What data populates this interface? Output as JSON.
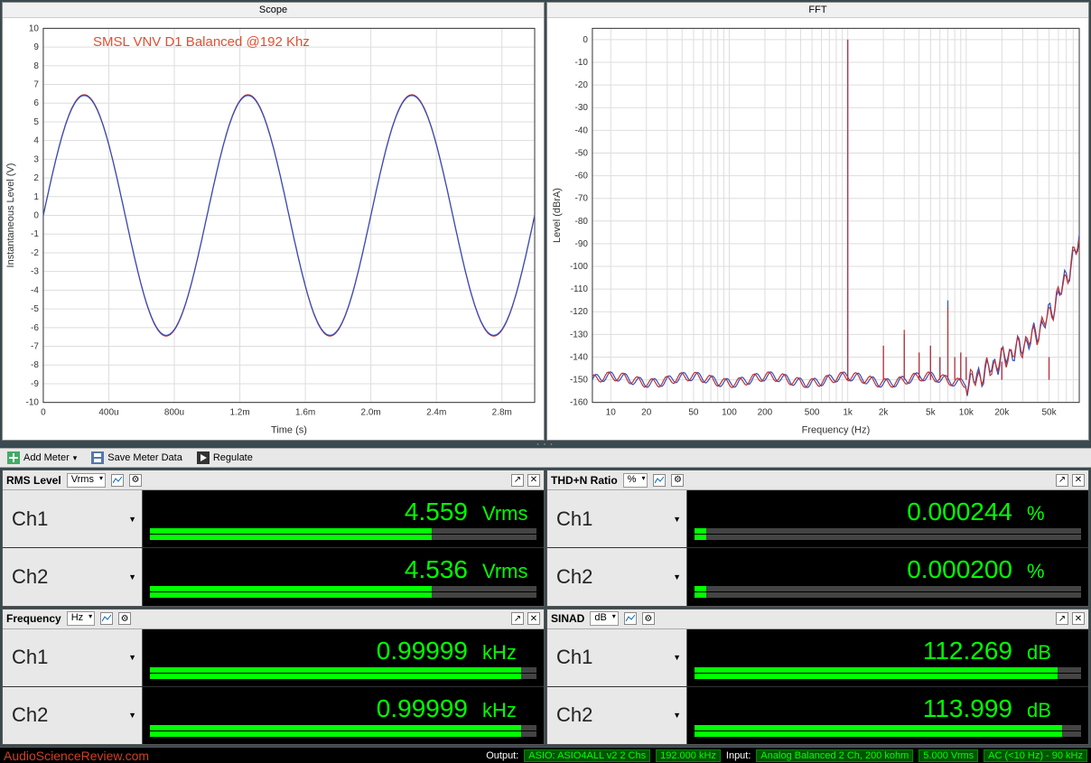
{
  "scope": {
    "title": "Scope",
    "xlabel": "Time (s)",
    "ylabel": "Instantaneous Level (V)",
    "annotation": "SMSL VNV D1 Balanced @192 Khz",
    "x_ticks": [
      "0",
      "400u",
      "800u",
      "1.2m",
      "1.6m",
      "2.0m",
      "2.4m",
      "2.8m"
    ],
    "y_ticks": [
      "-10",
      "-9",
      "-8",
      "-7",
      "-6",
      "-5",
      "-4",
      "-3",
      "-2",
      "-1",
      "0",
      "1",
      "2",
      "3",
      "4",
      "5",
      "6",
      "7",
      "8",
      "9",
      "10"
    ]
  },
  "fft": {
    "title": "FFT",
    "xlabel": "Frequency (Hz)",
    "ylabel": "Level (dBrA)",
    "x_ticks": [
      "10",
      "20",
      "50",
      "100",
      "200",
      "500",
      "1k",
      "2k",
      "5k",
      "10k",
      "20k",
      "50k"
    ],
    "y_ticks": [
      "-160",
      "-150",
      "-140",
      "-130",
      "-120",
      "-110",
      "-100",
      "-90",
      "-80",
      "-70",
      "-60",
      "-50",
      "-40",
      "-30",
      "-20",
      "-10",
      "0"
    ]
  },
  "toolbar": {
    "add_meter": "Add Meter",
    "save_meter": "Save Meter Data",
    "regulate": "Regulate"
  },
  "meters": {
    "rms": {
      "name": "RMS Level",
      "unit": "Vrms",
      "ch1": {
        "value": "4.559",
        "unit": "Vrms",
        "bar1": 73,
        "bar2": 73
      },
      "ch2": {
        "value": "4.536",
        "unit": "Vrms",
        "bar1": 73,
        "bar2": 73
      }
    },
    "thdn": {
      "name": "THD+N Ratio",
      "unit": "%",
      "ch1": {
        "value": "0.000244",
        "unit": "%",
        "bar1": 3,
        "bar2": 3
      },
      "ch2": {
        "value": "0.000200",
        "unit": "%",
        "bar1": 3,
        "bar2": 3
      }
    },
    "freq": {
      "name": "Frequency",
      "unit": "Hz",
      "ch1": {
        "value": "0.99999",
        "unit": "kHz",
        "bar1": 96,
        "bar2": 96
      },
      "ch2": {
        "value": "0.99999",
        "unit": "kHz",
        "bar1": 96,
        "bar2": 96
      }
    },
    "sinad": {
      "name": "SINAD",
      "unit": "dB",
      "ch1": {
        "value": "112.269",
        "unit": "dB",
        "bar1": 94,
        "bar2": 94
      },
      "ch2": {
        "value": "113.999",
        "unit": "dB",
        "bar1": 95,
        "bar2": 95
      }
    }
  },
  "channels": {
    "ch1": "Ch1",
    "ch2": "Ch2"
  },
  "status": {
    "watermark": "AudioScienceReview.com",
    "output_label": "Output:",
    "output_device": "ASIO: ASIO4ALL v2 2 Chs",
    "sample_rate": "192.000 kHz",
    "input_label": "Input:",
    "input_device": "Analog Balanced 2 Ch, 200 kohm",
    "input_level": "5.000 Vrms",
    "input_bw": "AC (<10 Hz) - 90 kHz"
  },
  "chart_data": [
    {
      "type": "line",
      "title": "Scope",
      "xlabel": "Time (s)",
      "ylabel": "Instantaneous Level (V)",
      "xlim": [
        0,
        0.003
      ],
      "ylim": [
        -10,
        10
      ],
      "series": [
        {
          "name": "Ch1",
          "color": "#c03030",
          "freq_hz": 1000,
          "amplitude_v": 6.45,
          "phase_deg": 0
        },
        {
          "name": "Ch2",
          "color": "#3050c0",
          "freq_hz": 1000,
          "amplitude_v": 6.41,
          "phase_deg": 0
        }
      ],
      "note": "sinusoid; both channels overlap visually"
    },
    {
      "type": "line",
      "title": "FFT",
      "xlabel": "Frequency (Hz)",
      "ylabel": "Level (dBrA)",
      "xscale": "log",
      "xlim": [
        7,
        90000
      ],
      "ylim": [
        -160,
        5
      ],
      "series": [
        {
          "name": "Ch1",
          "color": "#3050c0",
          "noise_floor_db": -150,
          "points": [
            {
              "f": 10,
              "db": -145
            },
            {
              "f": 20,
              "db": -148
            },
            {
              "f": 50,
              "db": -150
            },
            {
              "f": 100,
              "db": -150
            },
            {
              "f": 200,
              "db": -151
            },
            {
              "f": 500,
              "db": -150
            },
            {
              "f": 800,
              "db": -147
            },
            {
              "f": 1000,
              "db": 0
            },
            {
              "f": 2000,
              "db": -135
            },
            {
              "f": 3000,
              "db": -130
            },
            {
              "f": 4000,
              "db": -138
            },
            {
              "f": 5000,
              "db": -135
            },
            {
              "f": 6000,
              "db": -140
            },
            {
              "f": 7000,
              "db": -115
            },
            {
              "f": 8000,
              "db": -140
            },
            {
              "f": 9000,
              "db": -138
            },
            {
              "f": 10000,
              "db": -140
            },
            {
              "f": 20000,
              "db": -142
            },
            {
              "f": 50000,
              "db": -140
            }
          ]
        },
        {
          "name": "Ch2",
          "color": "#c03030",
          "noise_floor_db": -150,
          "points": [
            {
              "f": 10,
              "db": -147
            },
            {
              "f": 20,
              "db": -149
            },
            {
              "f": 50,
              "db": -150
            },
            {
              "f": 100,
              "db": -150
            },
            {
              "f": 200,
              "db": -151
            },
            {
              "f": 500,
              "db": -150
            },
            {
              "f": 800,
              "db": -147
            },
            {
              "f": 1000,
              "db": 0
            },
            {
              "f": 2000,
              "db": -135
            },
            {
              "f": 3000,
              "db": -128
            },
            {
              "f": 4000,
              "db": -138
            },
            {
              "f": 5000,
              "db": -135
            },
            {
              "f": 6000,
              "db": -140
            },
            {
              "f": 7000,
              "db": -118
            },
            {
              "f": 8000,
              "db": -140
            },
            {
              "f": 9000,
              "db": -138
            },
            {
              "f": 10000,
              "db": -140
            },
            {
              "f": 20000,
              "db": -142
            },
            {
              "f": 50000,
              "db": -140
            }
          ]
        }
      ]
    }
  ]
}
